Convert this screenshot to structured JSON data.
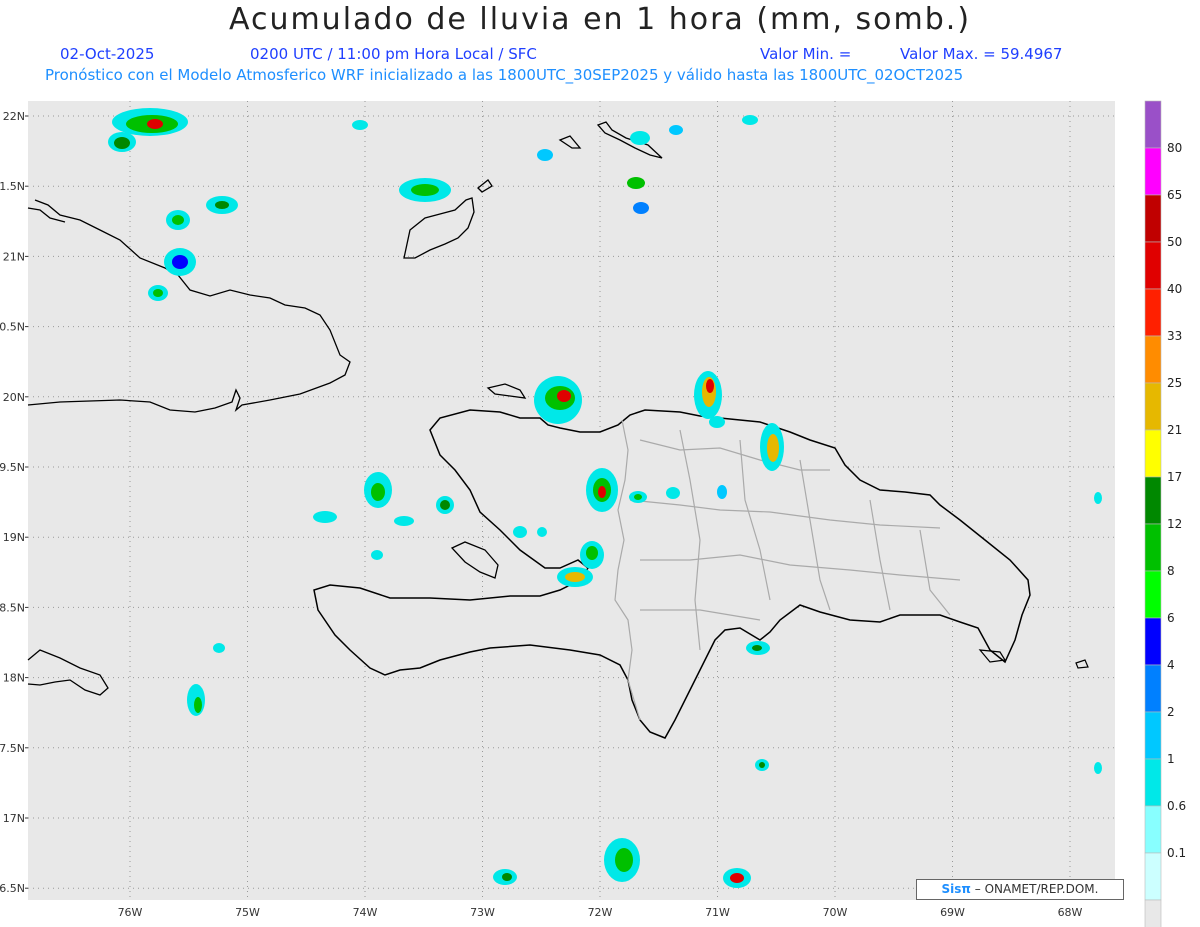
{
  "header": {
    "title": "Acumulado de lluvia en 1 hora (mm, somb.)",
    "date": "02-Oct-2025",
    "time": "0200 UTC / 11:00 pm Hora Local / SFC",
    "valor_min": "Valor Min. =",
    "valor_max": "Valor Max. = 59.4967",
    "model_line": "Pronóstico con el Modelo Atmosferico WRF inicializado a las 1800UTC_30SEP2025 y válido hasta las  1800UTC_02OCT2025"
  },
  "map": {
    "lat_labels": [
      "22N",
      "1.5N",
      "21N",
      "0.5N",
      "20N",
      "9.5N",
      "19N",
      "8.5N",
      "18N",
      "7.5N",
      "17N",
      "6.5N"
    ],
    "lon_labels": [
      "76W",
      "75W",
      "74W",
      "73W",
      "72W",
      "71W",
      "70W",
      "69W",
      "68W"
    ]
  },
  "legend": {
    "labels": [
      "80",
      "65",
      "50",
      "40",
      "33",
      "25",
      "21",
      "17",
      "12",
      "8",
      "6",
      "4",
      "2",
      "1",
      "0.6",
      "0.1"
    ],
    "colors": [
      "#9a50c8",
      "#ff00ff",
      "#c00000",
      "#e00000",
      "#ff2000",
      "#ff8c00",
      "#e6b800",
      "#ffff00",
      "#008800",
      "#00c000",
      "#00ff00",
      "#0000ff",
      "#0080ff",
      "#00c8ff",
      "#00e8e8",
      "#88ffff",
      "#ccffff",
      "#e8e8e8"
    ]
  },
  "credit": {
    "logo": "Sisπ",
    "text": "– ONAMET/REP.DOM."
  }
}
